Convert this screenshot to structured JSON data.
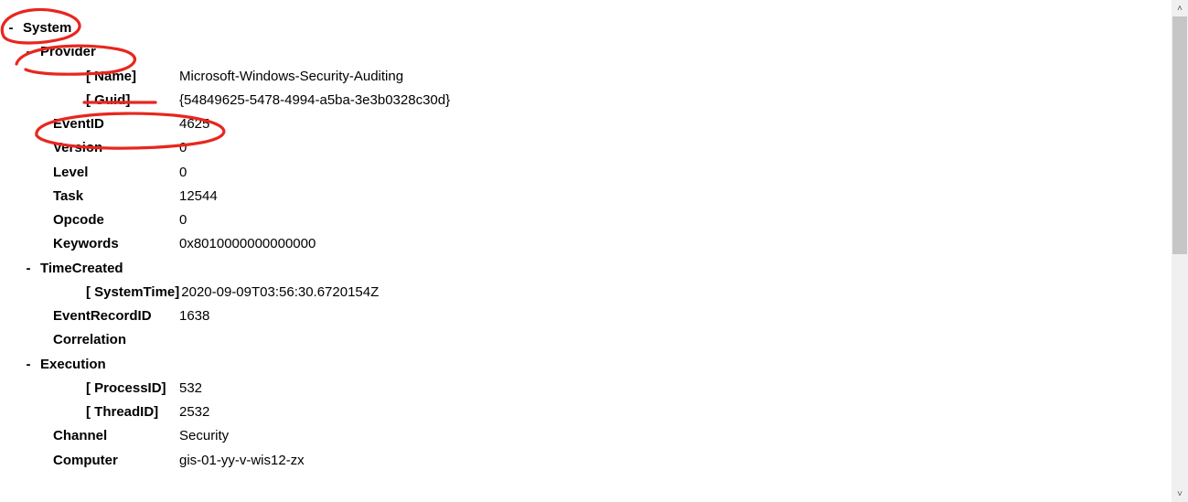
{
  "system": {
    "header": "System",
    "provider": {
      "header": "Provider",
      "name_label": "[ Name]",
      "name_value": "Microsoft-Windows-Security-Auditing",
      "guid_label": "[ Guid]",
      "guid_value": "{54849625-5478-4994-a5ba-3e3b0328c30d}"
    },
    "eventid": {
      "label": "EventID",
      "value": "4625"
    },
    "version": {
      "label": "Version",
      "value": "0"
    },
    "level": {
      "label": "Level",
      "value": "0"
    },
    "task": {
      "label": "Task",
      "value": "12544"
    },
    "opcode": {
      "label": "Opcode",
      "value": "0"
    },
    "keywords": {
      "label": "Keywords",
      "value": "0x8010000000000000"
    },
    "timecreated": {
      "header": "TimeCreated",
      "systemtime_label": "[ SystemTime]",
      "systemtime_value": "2020-09-09T03:56:30.6720154Z"
    },
    "eventrecordid": {
      "label": "EventRecordID",
      "value": "1638"
    },
    "correlation": {
      "label": "Correlation"
    },
    "execution": {
      "header": "Execution",
      "processid_label": "[ ProcessID]",
      "processid_value": "532",
      "threadid_label": "[ ThreadID]",
      "threadid_value": "2532"
    },
    "channel": {
      "label": "Channel",
      "value": "Security"
    },
    "computer": {
      "label": "Computer",
      "value": "gis-01-yy-v-wis12-zx"
    }
  },
  "glyphs": {
    "minus": "-",
    "up": "˄",
    "down": "˅"
  }
}
